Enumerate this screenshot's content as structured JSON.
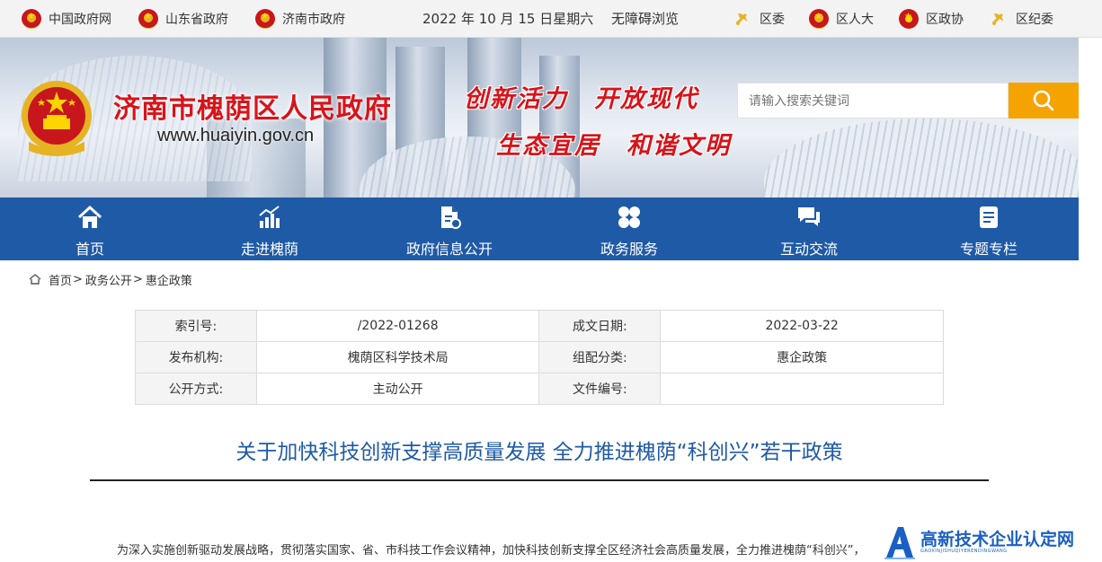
{
  "topbar": {
    "links_left": [
      "中国政府网",
      "山东省政府",
      "济南市政府"
    ],
    "date": "2022 年 10 月 15 日星期六",
    "accessibility": "无障碍浏览",
    "links_right": [
      "区委",
      "区人大",
      "区政协",
      "区纪委"
    ]
  },
  "banner": {
    "site_title": "济南市槐荫区人民政府",
    "site_url": "www.huaiyin.gov.cn",
    "slogan_line1": "创新活力　开放现代",
    "slogan_line2": "生态宜居　和谐文明",
    "search_placeholder": "请输入搜索关键词"
  },
  "nav": {
    "items": [
      {
        "label": "首页",
        "icon": "home-icon"
      },
      {
        "label": "走进槐荫",
        "icon": "chart-up-icon"
      },
      {
        "label": "政府信息公开",
        "icon": "document-icon"
      },
      {
        "label": "政务服务",
        "icon": "grid-icon"
      },
      {
        "label": "互动交流",
        "icon": "chat-icon"
      },
      {
        "label": "专题专栏",
        "icon": "list-icon"
      }
    ]
  },
  "breadcrumb": [
    "首页",
    "政务公开",
    "惠企政策"
  ],
  "meta": {
    "rows": [
      {
        "k1": "索引号:",
        "v1": "/2022-01268",
        "k2": "成文日期:",
        "v2": "2022-03-22"
      },
      {
        "k1": "发布机构:",
        "v1": "槐荫区科学技术局",
        "k2": "组配分类:",
        "v2": "惠企政策"
      },
      {
        "k1": "公开方式:",
        "v1": "主动公开",
        "k2": "文件编号:",
        "v2": ""
      }
    ]
  },
  "article": {
    "title": "关于加快科技创新支撑高质量发展 全力推进槐荫“科创兴”若干政策",
    "paragraph": "为深入实施创新驱动发展战略，贯彻落实国家、省、市科技工作会议精神，加快科技创新支撑全区经济社会高质量发展，全力推进槐荫“科创兴”，"
  },
  "watermark": {
    "title": "高新技术企业认定网",
    "subtitle": "GAOXINJISHUQIYERENDINGWANG"
  },
  "colors": {
    "brand_blue": "#1f5aa6",
    "title_red": "#d7141a",
    "search_orange": "#f5a300"
  }
}
